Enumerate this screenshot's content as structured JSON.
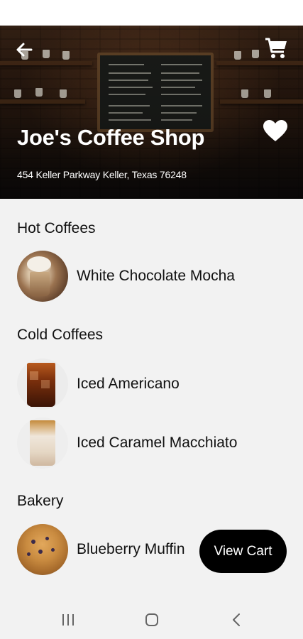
{
  "header": {
    "back_icon": "arrow-left-icon",
    "cart_icon": "shopping-cart-icon",
    "favorite_icon": "heart-icon",
    "shop_name": "Joe's Coffee Shop",
    "address": "454 Keller Parkway Keller, Texas 76248"
  },
  "menu": {
    "sections": [
      {
        "title": "Hot Coffees",
        "items": [
          {
            "name": "White Chocolate Mocha",
            "image": "white-chocolate-mocha-photo"
          }
        ]
      },
      {
        "title": "Cold Coffees",
        "items": [
          {
            "name": "Iced Americano",
            "image": "iced-americano-photo"
          },
          {
            "name": "Iced Caramel Macchiato",
            "image": "iced-caramel-macchiato-photo"
          }
        ]
      },
      {
        "title": "Bakery",
        "items": [
          {
            "name": "Blueberry Muffin",
            "image": "blueberry-muffin-photo"
          }
        ]
      }
    ]
  },
  "actions": {
    "view_cart_label": "View Cart"
  },
  "system_nav": {
    "recents_icon": "recents-icon",
    "home_icon": "home-icon",
    "back_icon": "system-back-icon"
  },
  "colors": {
    "background": "#f2f2f2",
    "button": "#000000",
    "hero_text": "#ffffff"
  }
}
